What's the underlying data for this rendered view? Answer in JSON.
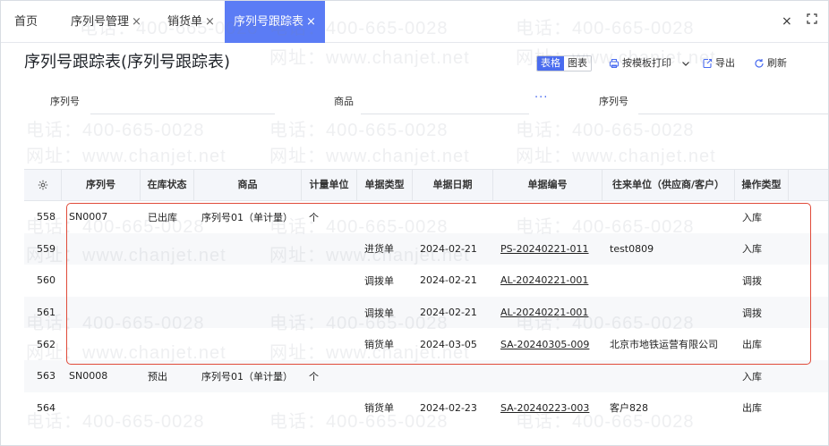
{
  "tabs": {
    "home": "首页",
    "serial_mgmt": "序列号管理",
    "sales_order": "销货单",
    "serial_trace": "序列号跟踪表",
    "close_glyph": "×"
  },
  "window": {
    "close_glyph": "×",
    "fullscreen_glyph": "⛶"
  },
  "page_title": "序列号跟踪表(序列号跟踪表)",
  "toolbar": {
    "view_table": "表格",
    "view_chart": "图表",
    "print_label": "按模板打印",
    "export_label": "导出",
    "refresh_label": "刷新"
  },
  "filters": {
    "serial_label": "序列号",
    "product_label": "商品",
    "more_dots": "···",
    "serial_label_2": "序列号"
  },
  "watermark": {
    "phone": "电话：400-665-0028",
    "site": "网址：www.chanjet.net"
  },
  "table": {
    "headers": [
      "序列号",
      "在库状态",
      "商品",
      "计量单位",
      "单据类型",
      "单据日期",
      "单据编号",
      "往来单位（供应商/客户）",
      "操作类型"
    ],
    "rows": [
      {
        "idx": "558",
        "serial": "SN0007",
        "status": "已出库",
        "product": "序列号01（单计量）",
        "unit": "个",
        "doc_type": "",
        "date": "",
        "doc_no": "",
        "partner": "",
        "op": "入库"
      },
      {
        "idx": "559",
        "serial": "",
        "status": "",
        "product": "",
        "unit": "",
        "doc_type": "进货单",
        "date": "2024-02-21",
        "doc_no": "PS-20240221-011",
        "partner": "test0809",
        "op": "入库"
      },
      {
        "idx": "560",
        "serial": "",
        "status": "",
        "product": "",
        "unit": "",
        "doc_type": "调拨单",
        "date": "2024-02-21",
        "doc_no": "AL-20240221-001",
        "partner": "",
        "op": "调拨"
      },
      {
        "idx": "561",
        "serial": "",
        "status": "",
        "product": "",
        "unit": "",
        "doc_type": "调拨单",
        "date": "2024-02-21",
        "doc_no": "AL-20240221-001",
        "partner": "",
        "op": "调拨"
      },
      {
        "idx": "562",
        "serial": "",
        "status": "",
        "product": "",
        "unit": "",
        "doc_type": "销货单",
        "date": "2024-03-05",
        "doc_no": "SA-20240305-009",
        "partner": "北京市地铁运营有限公司",
        "op": "出库"
      },
      {
        "idx": "563",
        "serial": "SN0008",
        "status": "预出",
        "product": "序列号01（单计量）",
        "unit": "个",
        "doc_type": "",
        "date": "",
        "doc_no": "",
        "partner": "",
        "op": "入库"
      },
      {
        "idx": "564",
        "serial": "",
        "status": "",
        "product": "",
        "unit": "",
        "doc_type": "销货单",
        "date": "2024-02-23",
        "doc_no": "SA-20240223-003",
        "partner": "客户828",
        "op": "出库"
      }
    ]
  },
  "colors": {
    "accent": "#5b7cf5",
    "highlight_border": "#e04b3a",
    "link": "#222222"
  }
}
